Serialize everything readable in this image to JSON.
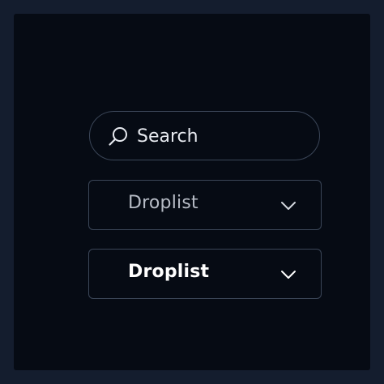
{
  "search": {
    "placeholder": "Search",
    "icon": "search-icon"
  },
  "droplists": [
    {
      "label": "Droplist",
      "icon": "chevron-down-icon",
      "state": "default"
    },
    {
      "label": "Droplist",
      "icon": "chevron-down-icon",
      "state": "active"
    }
  ],
  "colors": {
    "page_background": "#141d2e",
    "panel_background": "#060b14",
    "border": "#3b4658",
    "text_muted": "#b7bcc6",
    "text_active": "#ffffff"
  }
}
